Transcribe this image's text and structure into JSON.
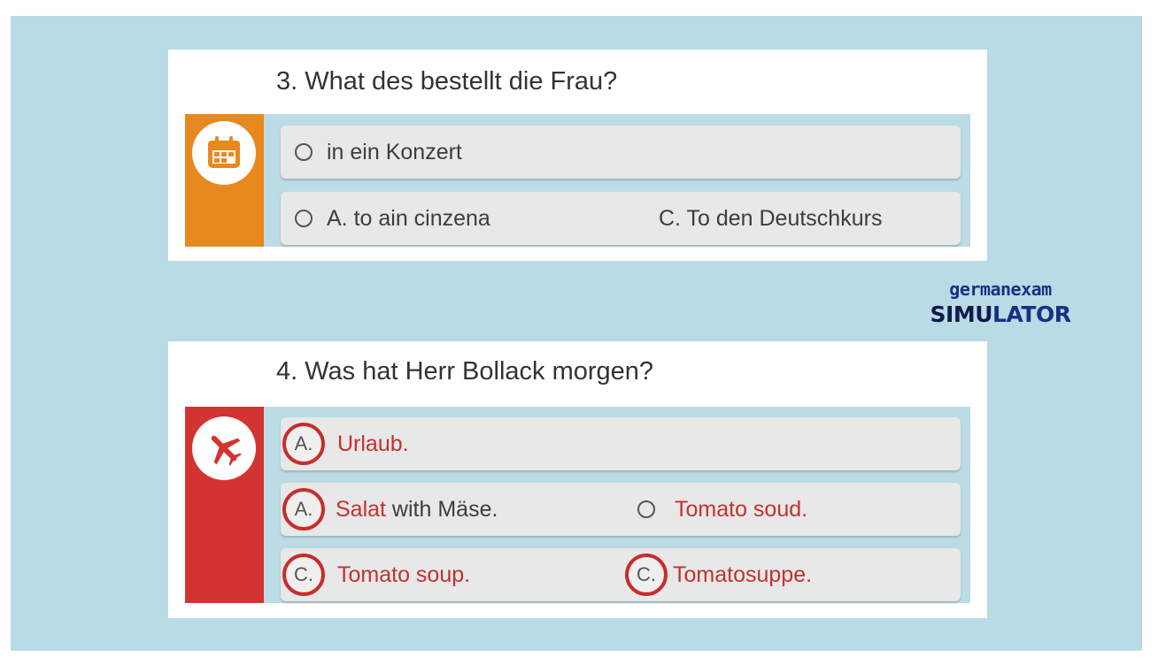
{
  "question3": {
    "title": "3. What des bestellt die Frau?",
    "icon": "calendar-icon",
    "accent_color": "#e8891f",
    "options": [
      {
        "text": "in ein Konzert"
      },
      {
        "text": "A. to ain cinzena"
      },
      {
        "text": "C. To den Deutschkurs"
      }
    ]
  },
  "question4": {
    "title": "4. Was hat Herr Bollack morgen?",
    "icon": "airplane-icon",
    "accent_color": "#d33431",
    "options": [
      {
        "badge": "A.",
        "text": "Urlaub."
      },
      {
        "badge": "A.",
        "text_red": "Salat",
        "text_rest": " with Mäse."
      },
      {
        "text": "Tomato soud."
      },
      {
        "badge": "C.",
        "text": "Tomato soup."
      },
      {
        "badge": "C.",
        "text": "Tomatosuppe."
      }
    ]
  },
  "brand": {
    "line1": "germanexam",
    "line2_part1": "SIMU",
    "line2_part2": "LATOR"
  }
}
